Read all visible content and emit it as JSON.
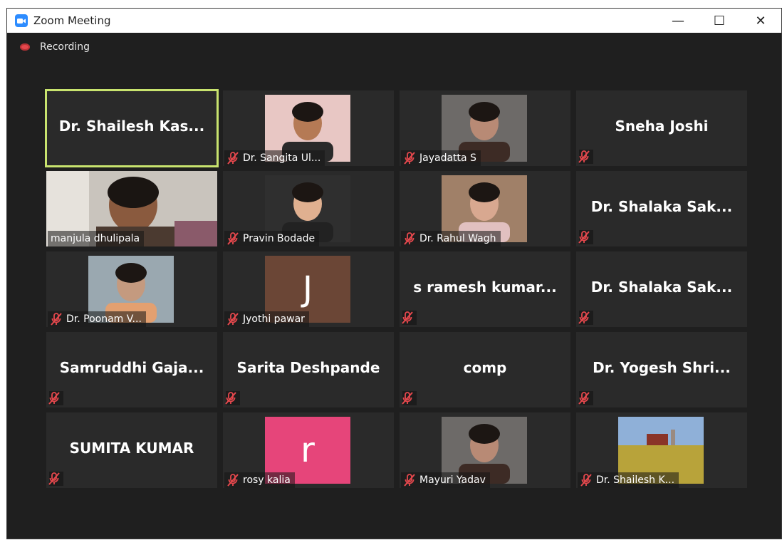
{
  "window": {
    "title": "Zoom Meeting"
  },
  "controls": {
    "minimize": "—",
    "maximize": "☐",
    "close": "✕"
  },
  "recording": {
    "label": "Recording"
  },
  "participants": [
    {
      "name": "Dr. Shailesh Kas...",
      "mode": "name",
      "active": true,
      "muted": false
    },
    {
      "name": "Dr. Sangita Ul...",
      "mode": "video",
      "muted": true
    },
    {
      "name": "Jayadatta S",
      "mode": "video",
      "muted": true
    },
    {
      "name": "Sneha Joshi",
      "mode": "name",
      "muted": true
    },
    {
      "name": "manjula dhulipala",
      "mode": "video-wide",
      "muted": false
    },
    {
      "name": "Pravin Bodade",
      "mode": "video",
      "muted": true
    },
    {
      "name": "Dr. Rahul Wagh",
      "mode": "video",
      "muted": true
    },
    {
      "name": "Dr. Shalaka Sak...",
      "mode": "name",
      "muted": true
    },
    {
      "name": "Dr. Poonam V...",
      "mode": "video",
      "muted": true
    },
    {
      "name": "Jyothi pawar",
      "mode": "initial",
      "initial": "J",
      "tile_color": "#6b4636",
      "muted": true
    },
    {
      "name": "s ramesh kumar...",
      "mode": "name",
      "muted": true
    },
    {
      "name": "Dr. Shalaka Sak...",
      "mode": "name",
      "muted": true
    },
    {
      "name": "Samruddhi Gaja...",
      "mode": "name",
      "muted": true
    },
    {
      "name": "Sarita Deshpande",
      "mode": "name",
      "muted": true
    },
    {
      "name": "comp",
      "mode": "name",
      "muted": true
    },
    {
      "name": "Dr. Yogesh Shri...",
      "mode": "name",
      "muted": true
    },
    {
      "name": "SUMITA KUMAR",
      "mode": "name",
      "muted": true
    },
    {
      "name": "rosy kalia",
      "mode": "initial",
      "initial": "r",
      "tile_color": "#e6457a",
      "muted": true
    },
    {
      "name": "Mayuri Yadav",
      "mode": "video",
      "muted": true
    },
    {
      "name": "Dr. Shailesh K...",
      "mode": "video",
      "muted": true
    }
  ],
  "colors": {
    "active_border": "#c8e36e",
    "mute_icon": "#e5484d",
    "app_icon": "#2d8cff"
  }
}
